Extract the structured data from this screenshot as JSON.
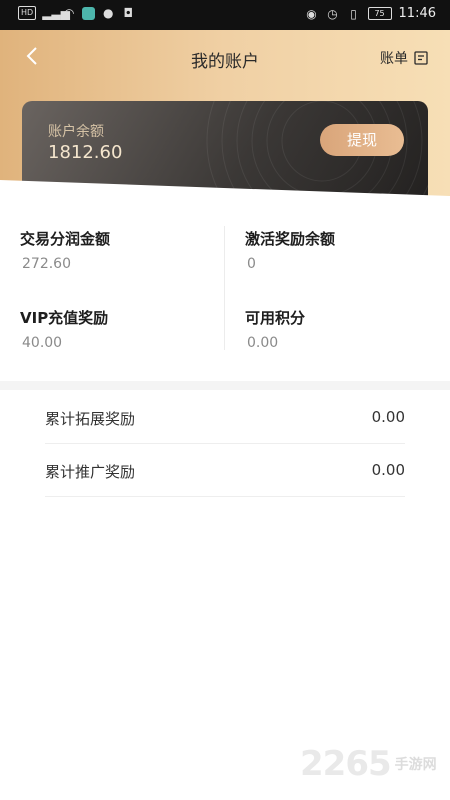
{
  "status_bar": {
    "left_chips": [
      "HD",
      "4G"
    ],
    "battery": "75",
    "time": "11:46"
  },
  "header": {
    "title": "我的账户",
    "bill_label": "账单"
  },
  "balance_card": {
    "label": "账户余额",
    "value": "1812.60",
    "withdraw_label": "提现"
  },
  "stats": [
    {
      "title": "交易分润金额",
      "value": "272.60"
    },
    {
      "title": "激活奖励余额",
      "value": "0"
    },
    {
      "title": "VIP充值奖励",
      "value": "40.00"
    },
    {
      "title": "可用积分",
      "value": "0.00"
    }
  ],
  "rows": [
    {
      "label": "累计拓展奖励",
      "value": "0.00"
    },
    {
      "label": "累计推广奖励",
      "value": "0.00"
    }
  ],
  "watermark": {
    "big": "2265",
    "small": "手游网"
  }
}
